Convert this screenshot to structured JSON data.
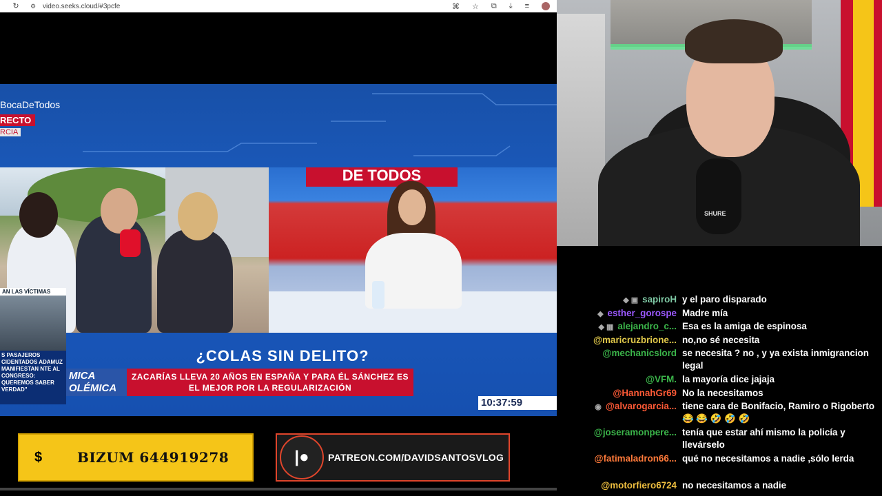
{
  "browser": {
    "url": "video.seeks.cloud/#3pcfe"
  },
  "tv": {
    "hashtag": "BocaDeTodos",
    "directo": "RECTO",
    "location": "RCIA",
    "studio_logo": "DE TODOS",
    "side_panel_label": "AN LAS VÍCTIMAS",
    "side_ticker": "S PASAJEROS CIDENTADOS ADAMUZ MANIFIESTAN NTE AL CONGRESO: QUEREMOS SABER VERDAD\"",
    "headline": "¿COLAS SIN DELITO?",
    "section": "MICA OLÉMICA",
    "subhead": "ZACARÍAS LLEVA 20 AÑOS EN ESPAÑA Y PARA ÉL SÁNCHEZ ES EL MEJOR POR LA REGULARIZACIÓN",
    "clock": "10:37:59"
  },
  "banners": {
    "bizum_symbol": "$",
    "bizum_text": "BIZUM 644919278",
    "patreon_text": "PATREON.COM/DAVIDSANTOSVLOG"
  },
  "webcam": {
    "mic_brand": "SHURE"
  },
  "chat": {
    "messages": [
      {
        "user": "sapiroH",
        "badges": "◆ ▣",
        "color": "#7ec8a4",
        "text": "y el paro disparado"
      },
      {
        "user": "esther_gorospe",
        "badges": "◆",
        "color": "#9b59ff",
        "text": "Madre mía"
      },
      {
        "user": "alejandro_c...",
        "badges": "◆ ▦",
        "color": "#3bb54a",
        "text": "Esa es la amiga de espinosa"
      },
      {
        "user": "@maricruzbrione...",
        "badges": "",
        "color": "#e0c84a",
        "text": "no,no sé necesita"
      },
      {
        "user": "@mechanicslord",
        "badges": "",
        "color": "#3bb54a",
        "text": "se necesita ? no , y ya exista inmigrancion legal"
      },
      {
        "user": "@VFM.",
        "badges": "",
        "color": "#3bb54a",
        "text": "la mayoría dice jajaja"
      },
      {
        "user": "@HannahGr69",
        "badges": "",
        "color": "#ff5a36",
        "text": "No la necesitamos"
      },
      {
        "user": "@alvarogarcia...",
        "badges": "◉",
        "color": "#ff5a36",
        "text": "tiene cara de Bonifacio, Ramiro o Rigoberto 😂 😂 🤣 🤣 🤣"
      },
      {
        "user": "@joseramonpere...",
        "badges": "",
        "color": "#3bb54a",
        "text": "tenía que estar ahí mismo la policía y llevárselo"
      },
      {
        "user": "@fatimaladron66...",
        "badges": "",
        "color": "#ff7a3a",
        "text": "qué no necesitamos a nadie ,sólo lerda"
      },
      {
        "user": "@motorfiero6724",
        "badges": "",
        "color": "#f0c040",
        "text": "no necesitamos a nadie"
      }
    ]
  }
}
